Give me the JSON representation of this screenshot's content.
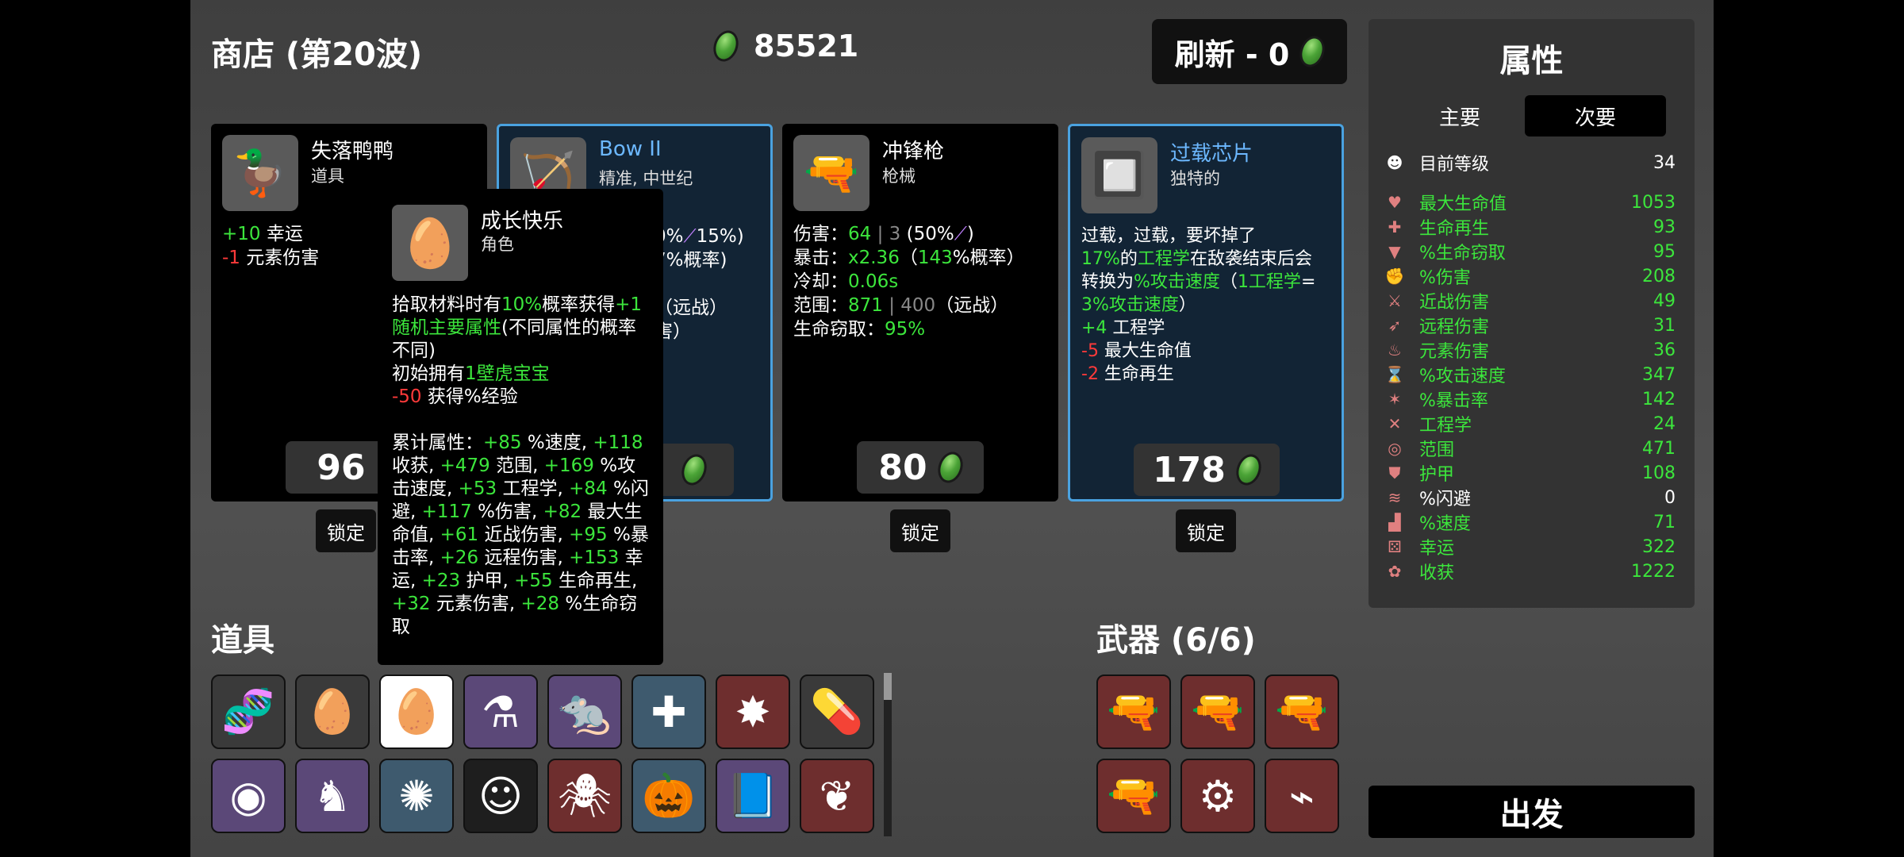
{
  "header": {
    "title": "商店 (第20波)",
    "money": "85521",
    "refresh_label": "刷新 - 0"
  },
  "shop": {
    "cards": [
      {
        "name": "失落鸭鸭",
        "type": "道具",
        "icon": "rubber-duck-icon",
        "lines": [
          [
            "+10",
            " 幸运"
          ],
          [
            "-1",
            " 元素伤害"
          ]
        ],
        "price": "96",
        "lock": "锁定"
      },
      {
        "name": "Bow II",
        "type": "精准, 中世纪",
        "icon": "crossbow-icon",
        "lines": [
          [
            "0%",
            "15%)"
          ],
          [
            "7%概率)"
          ],
          [
            "（远战）"
          ],
          [
            "害）"
          ]
        ],
        "price": "",
        "lock": "锁定"
      },
      {
        "name": "冲锋枪",
        "type": "枪械",
        "icon": "smg-icon",
        "lines": [
          "伤害：",
          "64",
          "| 3",
          "(50%",
          ")",
          "暴击：",
          "x2.36",
          "（",
          "143",
          "%概率）",
          "冷却：",
          "0.06s",
          "范围：",
          "871",
          "| 400",
          "（远战）",
          "生命窃取：",
          "95%"
        ],
        "price": "80",
        "lock": "锁定"
      },
      {
        "name": "过载芯片",
        "type": "独特的",
        "icon": "circuit-chip-icon",
        "lines": [
          "过载，过载，要坏掉了",
          "17%",
          "的",
          "工程学",
          "在敌袭结束后会",
          "转换为",
          "%攻击速度",
          "（",
          "1工程学",
          "=",
          "3%攻击速度",
          "）",
          "+4",
          " 工程学",
          "-5",
          " 最大生命值",
          "-2",
          " 生命再生"
        ],
        "price": "178",
        "lock": "锁定"
      }
    ]
  },
  "tooltip": {
    "name": "成长快乐",
    "type": "角色",
    "icon": "egg-face-icon",
    "desc1a": "拾取材料时有",
    "desc1b": "10%",
    "desc1c": "概率获得",
    "desc1d": "+1 随机主要属性",
    "desc1e": "(不同属性的概率不同)",
    "desc2a": "初始拥有",
    "desc2b": "1壁虎宝宝",
    "desc3a": "-50",
    "desc3b": " 获得%经验",
    "cum_label": "累计属性：",
    "cum": [
      [
        "+85",
        " %速度, "
      ],
      [
        "+118",
        " 收获, "
      ],
      [
        "+479",
        " 范围, "
      ],
      [
        "+169",
        " %攻击速度, "
      ],
      [
        "+53",
        " 工程学, "
      ],
      [
        "+84",
        " %闪避, "
      ],
      [
        "+117",
        " %伤害, "
      ],
      [
        "+82",
        " 最大生命值, "
      ],
      [
        "+61",
        " 近战伤害, "
      ],
      [
        "+95",
        " %暴击率, "
      ],
      [
        "+26",
        " 远程伤害, "
      ],
      [
        "+153",
        " 幸运, "
      ],
      [
        "+23",
        " 护甲, "
      ],
      [
        "+55",
        " 生命再生, "
      ],
      [
        "+32",
        " 元素伤害, "
      ],
      [
        "+28",
        " %生命窃取"
      ]
    ]
  },
  "items": {
    "title": "道具",
    "row1": [
      "dna-icon",
      "egg-icon",
      "egg-face-icon",
      "potion-icon",
      "rat-icon",
      "medic-robot-icon",
      "bullet-explosion-icon",
      "pill-icon"
    ],
    "row2": [
      "drone-icon",
      "gargoyle-icon",
      "turret-beetle-icon",
      "troll-face-icon",
      "spider-icon",
      "pumpkin-icon",
      "magic-book-icon",
      "leaf-icon"
    ]
  },
  "weapons": {
    "title": "武器 (6/6)",
    "slots": [
      "smg-icon",
      "smg-icon",
      "smg-icon",
      "smg-icon",
      "minigun-icon",
      "laser-gun-icon"
    ]
  },
  "stats": {
    "title": "属性",
    "tab_primary": "主要",
    "tab_secondary": "次要",
    "level_label": "目前等级",
    "level_value": "34",
    "rows": [
      {
        "label": "最大生命值",
        "value": "1053",
        "icon": "heart-icon",
        "color": "#3ce63c"
      },
      {
        "label": "生命再生",
        "value": "93",
        "icon": "heart-plus-icon",
        "color": "#3ce63c"
      },
      {
        "label": "%生命窃取",
        "value": "95",
        "icon": "fang-icon",
        "color": "#3ce63c"
      },
      {
        "label": "%伤害",
        "value": "208",
        "icon": "muscle-icon",
        "color": "#3ce63c"
      },
      {
        "label": "近战伤害",
        "value": "49",
        "icon": "sword-icon",
        "color": "#3ce63c"
      },
      {
        "label": "远程伤害",
        "value": "31",
        "icon": "bow-icon",
        "color": "#3ce63c"
      },
      {
        "label": "元素伤害",
        "value": "36",
        "icon": "flame-icon",
        "color": "#3ce63c"
      },
      {
        "label": "%攻击速度",
        "value": "347",
        "icon": "hourglass-icon",
        "color": "#3ce63c"
      },
      {
        "label": "%暴击率",
        "value": "142",
        "icon": "crit-icon",
        "color": "#3ce63c"
      },
      {
        "label": "工程学",
        "value": "24",
        "icon": "wrench-icon",
        "color": "#3ce63c"
      },
      {
        "label": "范围",
        "value": "471",
        "icon": "range-icon",
        "color": "#3ce63c"
      },
      {
        "label": "护甲",
        "value": "108",
        "icon": "shield-icon",
        "color": "#3ce63c"
      },
      {
        "label": "%闪避",
        "value": "0",
        "icon": "dodge-icon",
        "color": "#ffffff"
      },
      {
        "label": "%速度",
        "value": "71",
        "icon": "boot-icon",
        "color": "#3ce63c"
      },
      {
        "label": "幸运",
        "value": "322",
        "icon": "dice-icon",
        "color": "#3ce63c"
      },
      {
        "label": "收获",
        "value": "1222",
        "icon": "wheat-icon",
        "color": "#3ce63c"
      }
    ]
  },
  "depart_label": "出发"
}
